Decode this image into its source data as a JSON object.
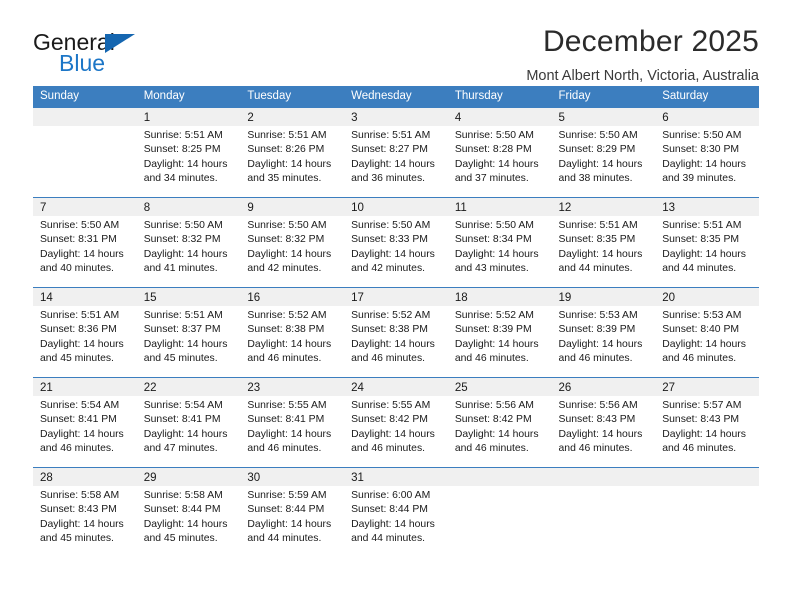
{
  "brand": {
    "name_top": "General",
    "name_bottom": "Blue",
    "triangle_color": "#1566b0",
    "blue_text_color": "#1c76c7"
  },
  "header": {
    "title": "December 2025",
    "subtitle": "Mont Albert North, Victoria, Australia"
  },
  "theme": {
    "header_bar_color": "#3c7ebf",
    "daynum_band_color": "#f0f0f0",
    "grid_line_color": "#3c7ebf"
  },
  "weekday_headers": [
    "Sunday",
    "Monday",
    "Tuesday",
    "Wednesday",
    "Thursday",
    "Friday",
    "Saturday"
  ],
  "labels": {
    "sunrise_prefix": "Sunrise:",
    "sunset_prefix": "Sunset:",
    "daylight_prefix": "Daylight:"
  },
  "weeks": [
    [
      {
        "day": "",
        "blank": true,
        "sunrise": "",
        "sunset": "",
        "daylight_line1": "",
        "daylight_line2": ""
      },
      {
        "day": "1",
        "sunrise": "Sunrise: 5:51 AM",
        "sunset": "Sunset: 8:25 PM",
        "daylight_line1": "Daylight: 14 hours",
        "daylight_line2": "and 34 minutes."
      },
      {
        "day": "2",
        "sunrise": "Sunrise: 5:51 AM",
        "sunset": "Sunset: 8:26 PM",
        "daylight_line1": "Daylight: 14 hours",
        "daylight_line2": "and 35 minutes."
      },
      {
        "day": "3",
        "sunrise": "Sunrise: 5:51 AM",
        "sunset": "Sunset: 8:27 PM",
        "daylight_line1": "Daylight: 14 hours",
        "daylight_line2": "and 36 minutes."
      },
      {
        "day": "4",
        "sunrise": "Sunrise: 5:50 AM",
        "sunset": "Sunset: 8:28 PM",
        "daylight_line1": "Daylight: 14 hours",
        "daylight_line2": "and 37 minutes."
      },
      {
        "day": "5",
        "sunrise": "Sunrise: 5:50 AM",
        "sunset": "Sunset: 8:29 PM",
        "daylight_line1": "Daylight: 14 hours",
        "daylight_line2": "and 38 minutes."
      },
      {
        "day": "6",
        "sunrise": "Sunrise: 5:50 AM",
        "sunset": "Sunset: 8:30 PM",
        "daylight_line1": "Daylight: 14 hours",
        "daylight_line2": "and 39 minutes."
      }
    ],
    [
      {
        "day": "7",
        "sunrise": "Sunrise: 5:50 AM",
        "sunset": "Sunset: 8:31 PM",
        "daylight_line1": "Daylight: 14 hours",
        "daylight_line2": "and 40 minutes."
      },
      {
        "day": "8",
        "sunrise": "Sunrise: 5:50 AM",
        "sunset": "Sunset: 8:32 PM",
        "daylight_line1": "Daylight: 14 hours",
        "daylight_line2": "and 41 minutes."
      },
      {
        "day": "9",
        "sunrise": "Sunrise: 5:50 AM",
        "sunset": "Sunset: 8:32 PM",
        "daylight_line1": "Daylight: 14 hours",
        "daylight_line2": "and 42 minutes."
      },
      {
        "day": "10",
        "sunrise": "Sunrise: 5:50 AM",
        "sunset": "Sunset: 8:33 PM",
        "daylight_line1": "Daylight: 14 hours",
        "daylight_line2": "and 42 minutes."
      },
      {
        "day": "11",
        "sunrise": "Sunrise: 5:50 AM",
        "sunset": "Sunset: 8:34 PM",
        "daylight_line1": "Daylight: 14 hours",
        "daylight_line2": "and 43 minutes."
      },
      {
        "day": "12",
        "sunrise": "Sunrise: 5:51 AM",
        "sunset": "Sunset: 8:35 PM",
        "daylight_line1": "Daylight: 14 hours",
        "daylight_line2": "and 44 minutes."
      },
      {
        "day": "13",
        "sunrise": "Sunrise: 5:51 AM",
        "sunset": "Sunset: 8:35 PM",
        "daylight_line1": "Daylight: 14 hours",
        "daylight_line2": "and 44 minutes."
      }
    ],
    [
      {
        "day": "14",
        "sunrise": "Sunrise: 5:51 AM",
        "sunset": "Sunset: 8:36 PM",
        "daylight_line1": "Daylight: 14 hours",
        "daylight_line2": "and 45 minutes."
      },
      {
        "day": "15",
        "sunrise": "Sunrise: 5:51 AM",
        "sunset": "Sunset: 8:37 PM",
        "daylight_line1": "Daylight: 14 hours",
        "daylight_line2": "and 45 minutes."
      },
      {
        "day": "16",
        "sunrise": "Sunrise: 5:52 AM",
        "sunset": "Sunset: 8:38 PM",
        "daylight_line1": "Daylight: 14 hours",
        "daylight_line2": "and 46 minutes."
      },
      {
        "day": "17",
        "sunrise": "Sunrise: 5:52 AM",
        "sunset": "Sunset: 8:38 PM",
        "daylight_line1": "Daylight: 14 hours",
        "daylight_line2": "and 46 minutes."
      },
      {
        "day": "18",
        "sunrise": "Sunrise: 5:52 AM",
        "sunset": "Sunset: 8:39 PM",
        "daylight_line1": "Daylight: 14 hours",
        "daylight_line2": "and 46 minutes."
      },
      {
        "day": "19",
        "sunrise": "Sunrise: 5:53 AM",
        "sunset": "Sunset: 8:39 PM",
        "daylight_line1": "Daylight: 14 hours",
        "daylight_line2": "and 46 minutes."
      },
      {
        "day": "20",
        "sunrise": "Sunrise: 5:53 AM",
        "sunset": "Sunset: 8:40 PM",
        "daylight_line1": "Daylight: 14 hours",
        "daylight_line2": "and 46 minutes."
      }
    ],
    [
      {
        "day": "21",
        "sunrise": "Sunrise: 5:54 AM",
        "sunset": "Sunset: 8:41 PM",
        "daylight_line1": "Daylight: 14 hours",
        "daylight_line2": "and 46 minutes."
      },
      {
        "day": "22",
        "sunrise": "Sunrise: 5:54 AM",
        "sunset": "Sunset: 8:41 PM",
        "daylight_line1": "Daylight: 14 hours",
        "daylight_line2": "and 47 minutes."
      },
      {
        "day": "23",
        "sunrise": "Sunrise: 5:55 AM",
        "sunset": "Sunset: 8:41 PM",
        "daylight_line1": "Daylight: 14 hours",
        "daylight_line2": "and 46 minutes."
      },
      {
        "day": "24",
        "sunrise": "Sunrise: 5:55 AM",
        "sunset": "Sunset: 8:42 PM",
        "daylight_line1": "Daylight: 14 hours",
        "daylight_line2": "and 46 minutes."
      },
      {
        "day": "25",
        "sunrise": "Sunrise: 5:56 AM",
        "sunset": "Sunset: 8:42 PM",
        "daylight_line1": "Daylight: 14 hours",
        "daylight_line2": "and 46 minutes."
      },
      {
        "day": "26",
        "sunrise": "Sunrise: 5:56 AM",
        "sunset": "Sunset: 8:43 PM",
        "daylight_line1": "Daylight: 14 hours",
        "daylight_line2": "and 46 minutes."
      },
      {
        "day": "27",
        "sunrise": "Sunrise: 5:57 AM",
        "sunset": "Sunset: 8:43 PM",
        "daylight_line1": "Daylight: 14 hours",
        "daylight_line2": "and 46 minutes."
      }
    ],
    [
      {
        "day": "28",
        "sunrise": "Sunrise: 5:58 AM",
        "sunset": "Sunset: 8:43 PM",
        "daylight_line1": "Daylight: 14 hours",
        "daylight_line2": "and 45 minutes."
      },
      {
        "day": "29",
        "sunrise": "Sunrise: 5:58 AM",
        "sunset": "Sunset: 8:44 PM",
        "daylight_line1": "Daylight: 14 hours",
        "daylight_line2": "and 45 minutes."
      },
      {
        "day": "30",
        "sunrise": "Sunrise: 5:59 AM",
        "sunset": "Sunset: 8:44 PM",
        "daylight_line1": "Daylight: 14 hours",
        "daylight_line2": "and 44 minutes."
      },
      {
        "day": "31",
        "sunrise": "Sunrise: 6:00 AM",
        "sunset": "Sunset: 8:44 PM",
        "daylight_line1": "Daylight: 14 hours",
        "daylight_line2": "and 44 minutes."
      },
      {
        "day": "",
        "blank": true,
        "sunrise": "",
        "sunset": "",
        "daylight_line1": "",
        "daylight_line2": ""
      },
      {
        "day": "",
        "blank": true,
        "sunrise": "",
        "sunset": "",
        "daylight_line1": "",
        "daylight_line2": ""
      },
      {
        "day": "",
        "blank": true,
        "sunrise": "",
        "sunset": "",
        "daylight_line1": "",
        "daylight_line2": ""
      }
    ]
  ]
}
